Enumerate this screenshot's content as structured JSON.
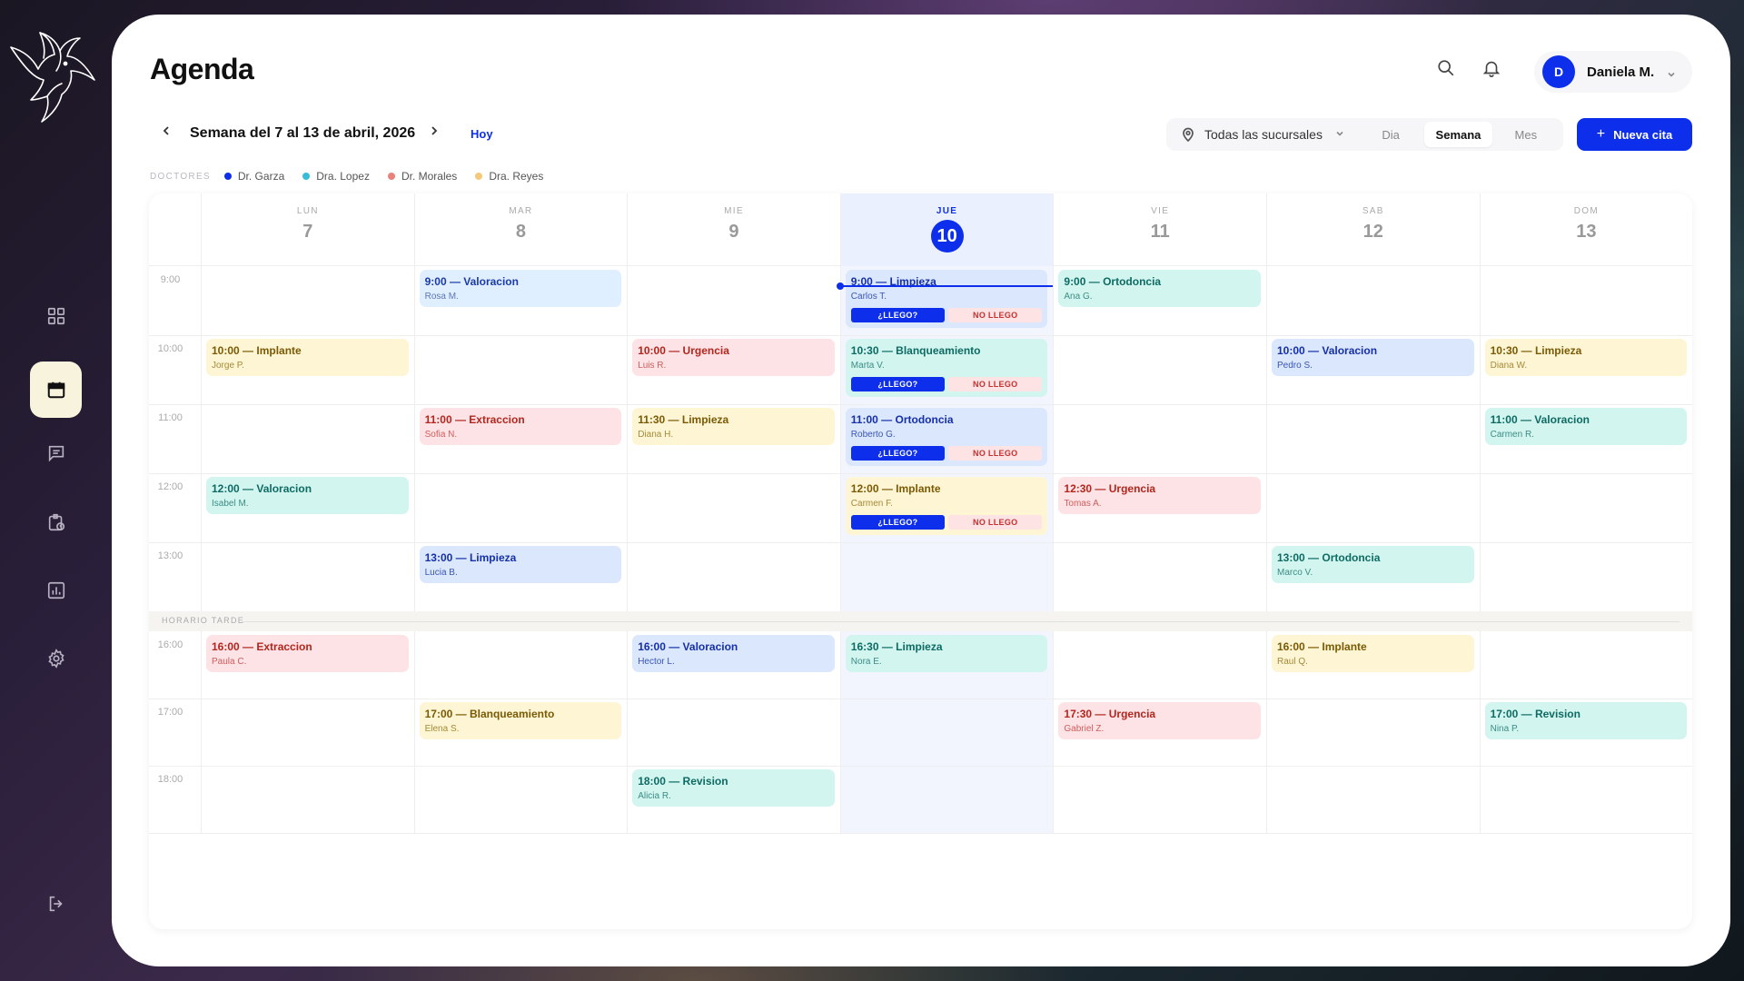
{
  "app": {
    "title": "Agenda"
  },
  "user": {
    "initial": "D",
    "name": "Daniela M."
  },
  "week": {
    "label": "Semana del 7 al 13 de abril, 2026",
    "today_label": "Hoy"
  },
  "branch": {
    "label": "Todas las sucursales"
  },
  "views": [
    "Dia",
    "Semana",
    "Mes"
  ],
  "active_view": "Semana",
  "new_button": {
    "label": "Nueva cita"
  },
  "legend": {
    "title": "DOCTORES",
    "items": [
      {
        "name": "Dr. Garza",
        "color": "#0d2eea"
      },
      {
        "name": "Dra. Lopez",
        "color": "#38bdd8"
      },
      {
        "name": "Dr. Morales",
        "color": "#e8827a"
      },
      {
        "name": "Dra. Reyes",
        "color": "#f5c97a"
      }
    ]
  },
  "days": [
    {
      "name": "LUN",
      "num": "7"
    },
    {
      "name": "MAR",
      "num": "8"
    },
    {
      "name": "MIE",
      "num": "9"
    },
    {
      "name": "JUE",
      "num": "10",
      "today": true
    },
    {
      "name": "VIE",
      "num": "11"
    },
    {
      "name": "SAB",
      "num": "12"
    },
    {
      "name": "DOM",
      "num": "13"
    }
  ],
  "hours_morning": [
    "9:00",
    "10:00",
    "11:00",
    "12:00",
    "13:00"
  ],
  "afternoon_label": "HORARIO TARDE",
  "hours_afternoon": [
    "16:00",
    "17:00",
    "18:00"
  ],
  "action_labels": {
    "arrived": "¿LLEGO?",
    "no_show": "NO LLEGO"
  },
  "appointments": [
    {
      "day": 1,
      "slot": 0,
      "title": "9:00 — Valoracion",
      "patient": "Rosa M.",
      "color": "lblue"
    },
    {
      "day": 3,
      "slot": 0,
      "title": "9:00 — Limpieza",
      "patient": "Carlos T.",
      "color": "blue",
      "actions": true
    },
    {
      "day": 4,
      "slot": 0,
      "title": "9:00 — Ortodoncia",
      "patient": "Ana G.",
      "color": "teal"
    },
    {
      "day": 0,
      "slot": 1,
      "title": "10:00 — Implante",
      "patient": "Jorge P.",
      "color": "yellow"
    },
    {
      "day": 2,
      "slot": 1,
      "title": "10:00 — Urgencia",
      "patient": "Luis R.",
      "color": "red"
    },
    {
      "day": 3,
      "slot": 1,
      "title": "10:30 — Blanqueamiento",
      "patient": "Marta V.",
      "color": "teal",
      "actions": true
    },
    {
      "day": 5,
      "slot": 1,
      "title": "10:00 — Valoracion",
      "patient": "Pedro S.",
      "color": "blue"
    },
    {
      "day": 6,
      "slot": 1,
      "title": "10:30 — Limpieza",
      "patient": "Diana W.",
      "color": "yellow"
    },
    {
      "day": 1,
      "slot": 2,
      "title": "11:00 — Extraccion",
      "patient": "Sofia N.",
      "color": "red"
    },
    {
      "day": 2,
      "slot": 2,
      "title": "11:30 — Limpieza",
      "patient": "Diana H.",
      "color": "yellow"
    },
    {
      "day": 3,
      "slot": 2,
      "title": "11:00 — Ortodoncia",
      "patient": "Roberto G.",
      "color": "blue",
      "actions": true
    },
    {
      "day": 6,
      "slot": 2,
      "title": "11:00 — Valoracion",
      "patient": "Carmen R.",
      "color": "teal"
    },
    {
      "day": 0,
      "slot": 3,
      "title": "12:00 — Valoracion",
      "patient": "Isabel M.",
      "color": "teal"
    },
    {
      "day": 3,
      "slot": 3,
      "title": "12:00 — Implante",
      "patient": "Carmen F.",
      "color": "yellow",
      "actions": true
    },
    {
      "day": 4,
      "slot": 3,
      "title": "12:30 — Urgencia",
      "patient": "Tomas A.",
      "color": "red"
    },
    {
      "day": 1,
      "slot": 4,
      "title": "13:00 — Limpieza",
      "patient": "Lucia B.",
      "color": "blue"
    },
    {
      "day": 5,
      "slot": 4,
      "title": "13:00 — Ortodoncia",
      "patient": "Marco V.",
      "color": "teal"
    },
    {
      "day": 0,
      "slot": 5,
      "title": "16:00 — Extraccion",
      "patient": "Paula C.",
      "color": "red"
    },
    {
      "day": 2,
      "slot": 5,
      "title": "16:00 — Valoracion",
      "patient": "Hector L.",
      "color": "blue"
    },
    {
      "day": 3,
      "slot": 5,
      "title": "16:30 — Limpieza",
      "patient": "Nora E.",
      "color": "teal"
    },
    {
      "day": 5,
      "slot": 5,
      "title": "16:00 — Implante",
      "patient": "Raul Q.",
      "color": "yellow"
    },
    {
      "day": 1,
      "slot": 6,
      "title": "17:00 — Blanqueamiento",
      "patient": "Elena S.",
      "color": "yellow"
    },
    {
      "day": 4,
      "slot": 6,
      "title": "17:30 — Urgencia",
      "patient": "Gabriel Z.",
      "color": "red"
    },
    {
      "day": 6,
      "slot": 6,
      "title": "17:00 — Revision",
      "patient": "Nina P.",
      "color": "teal"
    },
    {
      "day": 2,
      "slot": 7,
      "title": "18:00 — Revision",
      "patient": "Alicia R.",
      "color": "teal"
    }
  ]
}
